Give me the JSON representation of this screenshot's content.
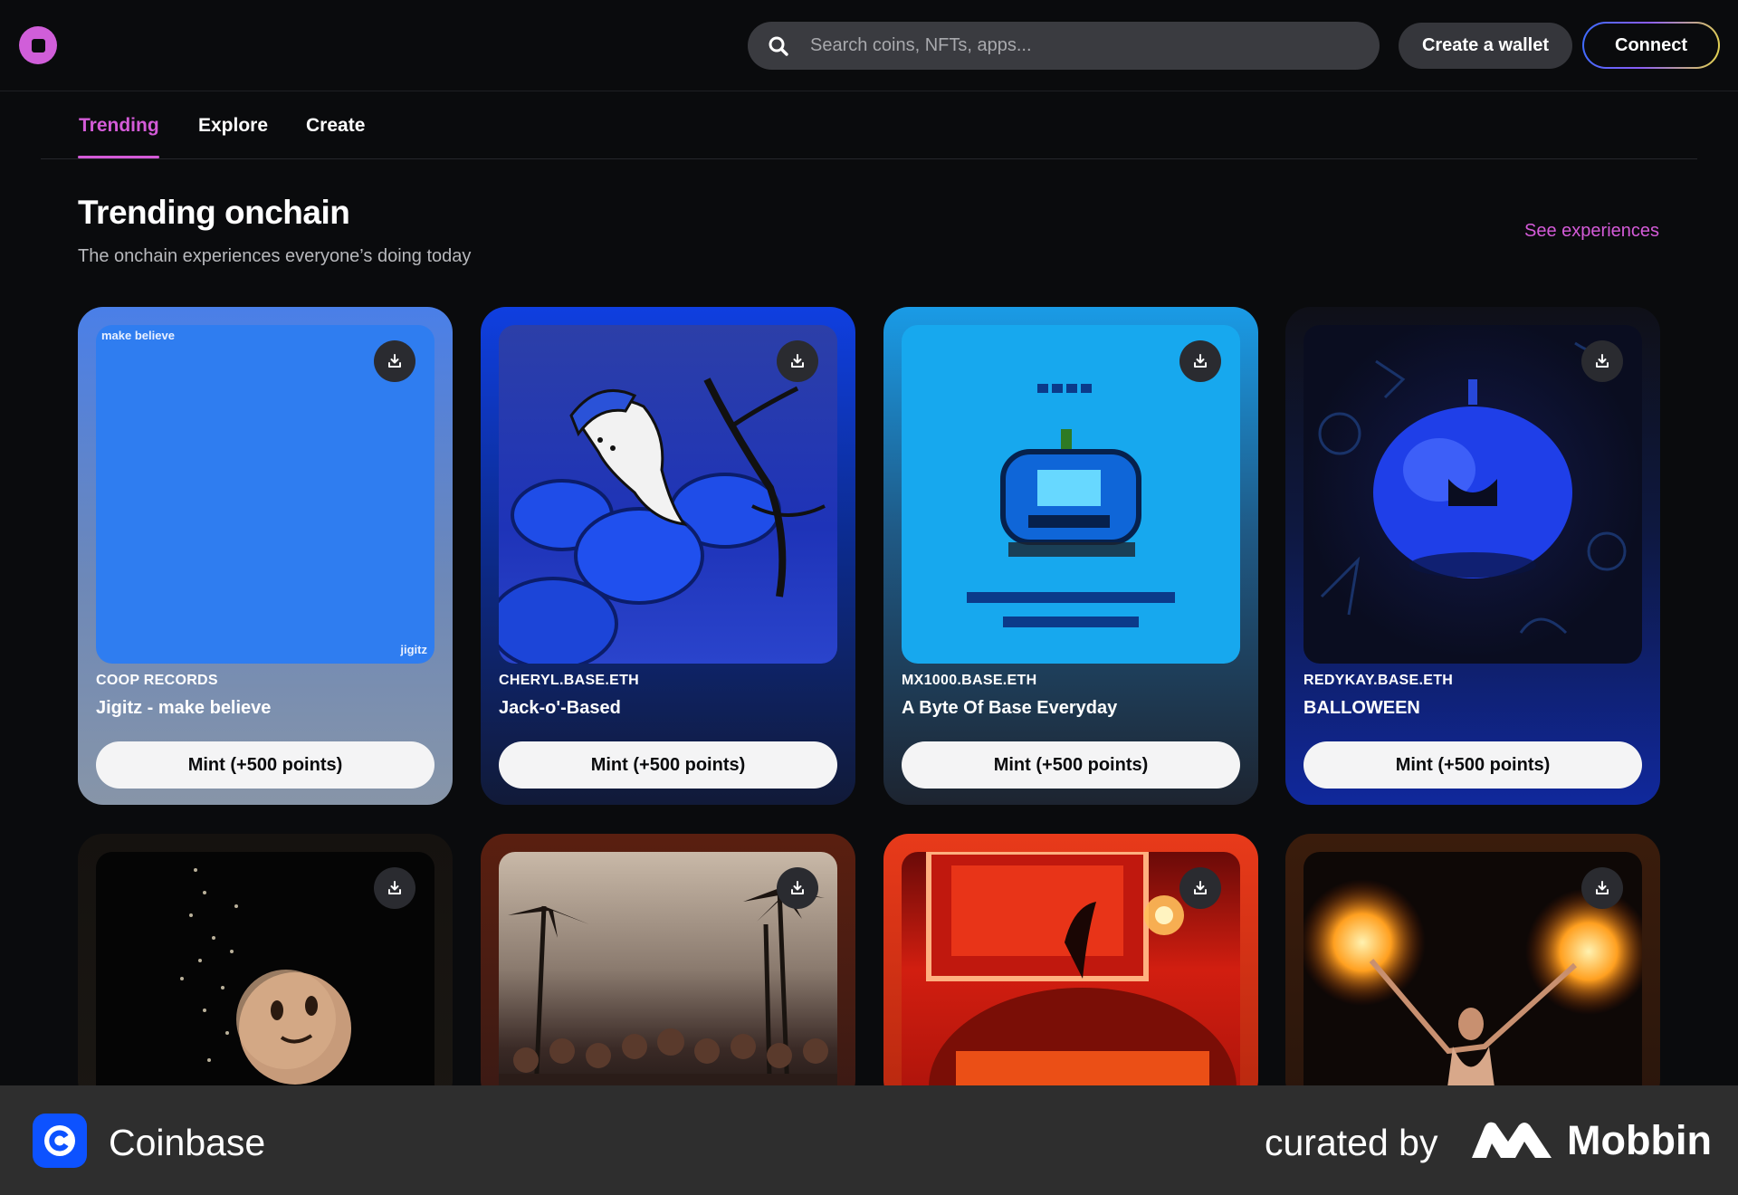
{
  "search": {
    "placeholder": "Search coins, NFTs, apps..."
  },
  "header": {
    "create_wallet": "Create a wallet",
    "connect": "Connect"
  },
  "tabs": [
    {
      "label": "Trending",
      "active": true
    },
    {
      "label": "Explore",
      "active": false
    },
    {
      "label": "Create",
      "active": false
    }
  ],
  "section": {
    "title": "Trending onchain",
    "subtitle": "The onchain experiences everyone’s doing today",
    "see_all": "See experiences"
  },
  "cards": [
    {
      "creator": "COOP RECORDS",
      "title": "Jigitz - make believe",
      "mint": "Mint (+500 points)",
      "art_text_top": "make believe",
      "art_text_bottom": "jigitz"
    },
    {
      "creator": "CHERYL.BASE.ETH",
      "title": "Jack-o'-Based",
      "mint": "Mint (+500 points)"
    },
    {
      "creator": "MX1000.BASE.ETH",
      "title": "A Byte Of Base Everyday",
      "mint": "Mint (+500 points)"
    },
    {
      "creator": "REDYKAY.BASE.ETH",
      "title": "BALLOWEEN",
      "mint": "Mint (+500 points)"
    },
    {
      "creator": "",
      "title": "",
      "mint": ""
    },
    {
      "creator": "",
      "title": "",
      "mint": ""
    },
    {
      "creator": "",
      "title": "",
      "mint": ""
    },
    {
      "creator": "",
      "title": "",
      "mint": ""
    }
  ],
  "footer": {
    "app_name": "Coinbase",
    "curated_by": "curated by",
    "brand": "Mobbin"
  },
  "colors": {
    "accent": "#d45bd8",
    "background": "#0a0b0d",
    "coinbase_blue": "#0d52ff"
  },
  "icons": [
    "search-icon",
    "download-icon",
    "coinbase-logo",
    "mobbin-logo"
  ]
}
